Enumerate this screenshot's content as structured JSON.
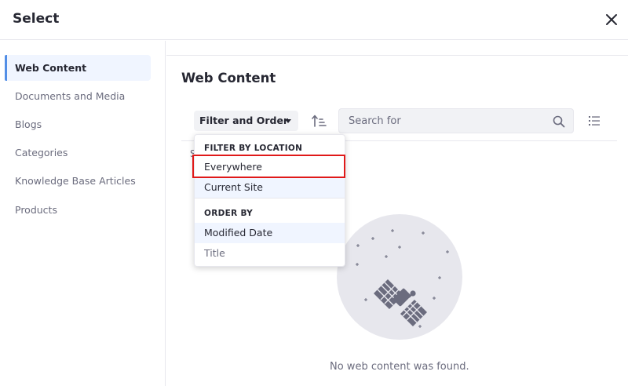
{
  "modal": {
    "title": "Select"
  },
  "sidebar": {
    "items": [
      {
        "label": "Web Content",
        "active": true
      },
      {
        "label": "Documents and Media",
        "active": false
      },
      {
        "label": "Blogs",
        "active": false
      },
      {
        "label": "Categories",
        "active": false
      },
      {
        "label": "Knowledge Base Articles",
        "active": false
      },
      {
        "label": "Products",
        "active": false
      }
    ]
  },
  "main": {
    "title": "Web Content",
    "toolbar": {
      "filter_label": "Filter and Order",
      "search_placeholder": "Search for",
      "search_value": ""
    },
    "truncated_label": "S",
    "empty_message": "No web content was found."
  },
  "dropdown": {
    "filter_header": "FILTER BY LOCATION",
    "filter_items": [
      {
        "label": "Everywhere",
        "selected": true
      },
      {
        "label": "Current Site"
      }
    ],
    "order_header": "ORDER BY",
    "order_items": [
      {
        "label": "Modified Date",
        "selected": true
      },
      {
        "label": "Title"
      }
    ]
  },
  "colors": {
    "accent": "#528ee6",
    "active_bg": "#f0f5ff",
    "input_bg": "#f1f2f5",
    "highlight_border": "#e01919",
    "illustration_bg": "#e7e7ed",
    "illustration_fg": "#6b6c7e"
  },
  "icons": [
    "close-icon",
    "chevron-down-icon",
    "sort-ascending-icon",
    "search-icon",
    "list-view-icon",
    "satellite-icon"
  ]
}
